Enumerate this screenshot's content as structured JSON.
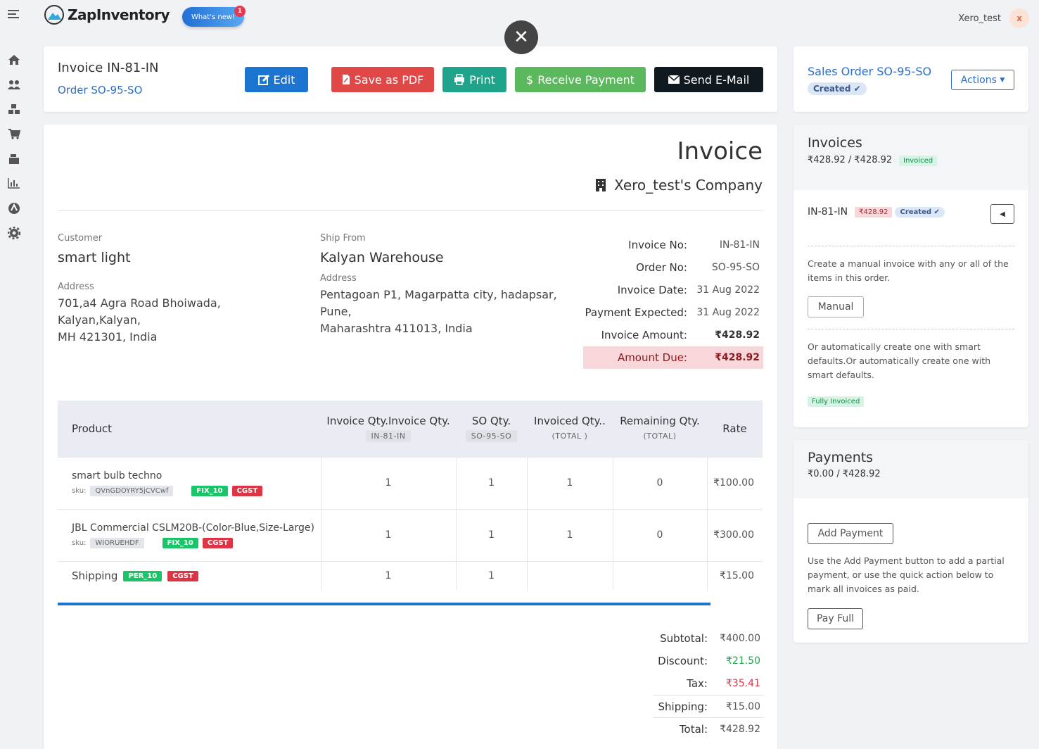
{
  "app": {
    "name": "ZapInventory",
    "whats_new": "What's new!",
    "whats_new_count": "1",
    "user": "Xero_test",
    "user_initial": "x"
  },
  "sidebar": {
    "items": [
      "menu-icon",
      "home-icon",
      "users-icon",
      "boxes-icon",
      "cart-icon",
      "register-icon",
      "chart-icon",
      "compass-icon",
      "gear-icon"
    ]
  },
  "header": {
    "invoice_title": "Invoice IN-81-IN",
    "order_link": "Order SO-95-SO",
    "buttons": {
      "edit": "Edit",
      "pdf": "Save as PDF",
      "print": "Print",
      "receive": "Receive Payment",
      "email": "Send E-Mail"
    }
  },
  "invoice": {
    "heading": "Invoice",
    "company": "Xero_test's Company",
    "customer_label": "Customer",
    "customer": "smart light",
    "address_label": "Address",
    "customer_address": [
      "701,a4 Agra Road Bhoiwada,",
      "Kalyan,Kalyan,",
      "MH 421301, India"
    ],
    "ship_from_label": "Ship From",
    "ship_from": "Kalyan Warehouse",
    "ship_address_label": "Address",
    "ship_address": [
      "Pentagoan P1, Magarpatta city, hadapsar,",
      "Pune,",
      "Maharashtra 411013, India"
    ],
    "meta": [
      {
        "k": "Invoice No:",
        "v": "IN-81-IN"
      },
      {
        "k": "Order No:",
        "v": "SO-95-SO"
      },
      {
        "k": "Invoice Date:",
        "v": "31 Aug 2022"
      },
      {
        "k": "Payment Expected:",
        "v": "31 Aug 2022"
      },
      {
        "k": "Invoice Amount:",
        "v": "₹428.92"
      },
      {
        "k": "Amount Due:",
        "v": "₹428.92"
      }
    ]
  },
  "table": {
    "headers": {
      "product": "Product",
      "inv_qty": "Invoice Qty.Invoice Qty.",
      "inv_qty_sub": "IN-81-IN",
      "so_qty": "SO Qty.",
      "so_qty_sub": "SO-95-SO",
      "invoiced_qty": "Invoiced Qty..",
      "invoiced_sub": "(TOTAL )",
      "remaining": "Remaining Qty.",
      "remaining_sub": "(TOTAL)",
      "rate": "Rate"
    },
    "rows": [
      {
        "name": "smart bulb techno",
        "sku_label": "sku:",
        "sku": "QVnGDOYRY5jCVCwf",
        "tag1": "FIX_10",
        "tag2": "CGST",
        "inv": "1",
        "so": "1",
        "invoiced": "1",
        "remaining": "0",
        "rate": "₹100.00"
      },
      {
        "name": "JBL Commercial CSLM20B-(Color-Blue,Size-Large)",
        "sku_label": "sku:",
        "sku": "WIORUEHDF",
        "tag1": "FIX_10",
        "tag2": "CGST",
        "inv": "1",
        "so": "1",
        "invoiced": "1",
        "remaining": "0",
        "rate": "₹300.00"
      }
    ],
    "shipping": {
      "name": "Shipping",
      "tag1": "PER_10",
      "tag2": "CGST",
      "inv": "1",
      "so": "1",
      "rate": "₹15.00"
    }
  },
  "totals": [
    {
      "k": "Subtotal:",
      "v": "₹400.00"
    },
    {
      "k": "Discount:",
      "v": "₹21.50"
    },
    {
      "k": "Tax:",
      "v": "₹35.41"
    },
    {
      "k": "Shipping:",
      "v": "₹15.00"
    },
    {
      "k": "Total:",
      "v": "₹428.92"
    }
  ],
  "colors": {
    "discount": "#1fa849",
    "tax": "#dc3545",
    "primary": "#1b75d0"
  },
  "sales_order": {
    "link": "Sales Order SO-95-SO",
    "status": "Created",
    "actions": "Actions"
  },
  "invoices_panel": {
    "title": "Invoices",
    "amount": "₹428.92 / ₹428.92",
    "status": "Invoiced",
    "item": "IN-81-IN",
    "item_amount": "₹428.92",
    "item_status": "Created",
    "manual_text": "Create a manual invoice with any or all of the items in this order.",
    "manual_btn": "Manual",
    "auto_text": "Or automatically create one with smart defaults.Or automatically create one with smart defaults.",
    "fully": "Fully Invoiced"
  },
  "payments_panel": {
    "title": "Payments",
    "amount": "₹0.00 / ₹428.92",
    "add_btn": "Add Payment",
    "text": "Use the Add Payment button to add a partial payment, or use the quick action below to mark all invoices as paid.",
    "pay_full": "Pay Full"
  }
}
